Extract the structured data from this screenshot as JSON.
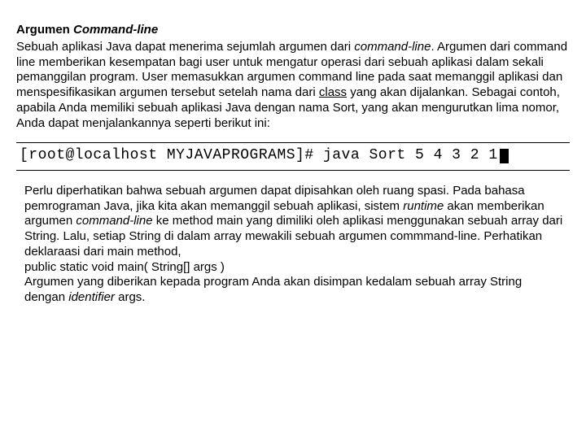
{
  "heading_prefix": "Argumen ",
  "heading_cmd": "Command-line",
  "p1_a": "Sebuah aplikasi Java dapat menerima sejumlah argumen dari ",
  "p1_cmd": "command-line",
  "p1_b": ". Argumen dari command line memberikan kesempatan bagi user untuk mengatur operasi dari sebuah aplikasi dalam sekali pemanggilan program. User memasukkan argumen command line pada saat memanggil aplikasi dan menspesifikasikan argumen tersebut setelah nama dari ",
  "p1_class": "class",
  "p1_c": " yang akan dijalankan. Sebagai contoh, apabila Anda memiliki sebuah aplikasi Java dengan nama Sort, yang akan mengurutkan lima nomor, Anda dapat menjalankannya seperti berikut ini:",
  "terminal": "[root@localhost MYJAVAPROGRAMS]# java Sort 5 4 3 2 1",
  "p2_a": "Perlu diperhatikan bahwa sebuah argumen dapat dipisahkan oleh ruang spasi. Pada bahasa pemrograman Java, jika kita akan memanggil sebuah aplikasi, sistem ",
  "p2_runtime": "runtime",
  "p2_b": " akan memberikan argumen ",
  "p2_cmd": "command-line",
  "p2_c": " ke method main yang dimiliki oleh aplikasi menggunakan sebuah array dari String. Lalu, setiap String di dalam array mewakili sebuah argumen commmand-line. Perhatikan deklaraasi dari main method,",
  "p2_code": "public static void main( String[] args )",
  "p2_d": "Argumen yang diberikan kepada program Anda akan disimpan kedalam sebuah array String dengan ",
  "p2_identifier": "identifier",
  "p2_e": " args."
}
